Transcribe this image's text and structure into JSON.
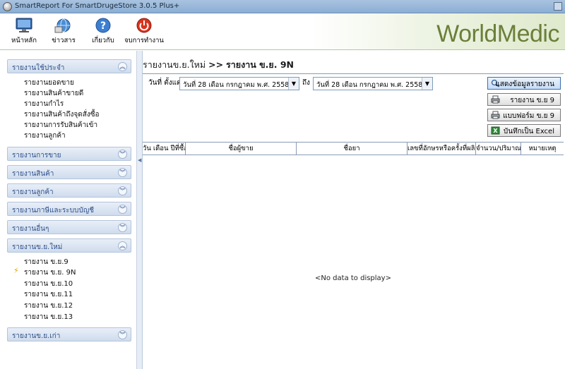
{
  "window": {
    "title": "SmartReport For SmartDrugeStore 3.0.5 Plus+"
  },
  "toolbar": {
    "brand": "WorldMedic",
    "buttons": [
      {
        "label": "หน้าหลัก",
        "icon": "monitor-icon"
      },
      {
        "label": "ข่าวสาร",
        "icon": "globe-icon"
      },
      {
        "label": "เกี่ยวกับ",
        "icon": "help-icon"
      },
      {
        "label": "จบการทำงาน",
        "icon": "power-icon"
      }
    ]
  },
  "sidebar": {
    "groups": [
      {
        "label": "รายงานใช้ประจำ",
        "expanded": true,
        "items": [
          "รายงานยอดขาย",
          "รายงานสินค้าขายดี",
          "รายงานกำไร",
          "รายงานสินค้าถึงจุดสั่งซื้อ",
          "รายงานการรับสินค้าเข้า",
          "รายงานลูกค้า"
        ]
      },
      {
        "label": "รายงานการขาย",
        "expanded": false
      },
      {
        "label": "รายงานสินค้า",
        "expanded": false
      },
      {
        "label": "รายงานลูกค้า",
        "expanded": false
      },
      {
        "label": "รายงานภาษีและระบบบัญชี",
        "expanded": false
      },
      {
        "label": "รายงานอื่นๆ",
        "expanded": false
      },
      {
        "label": "รายงานข.ย.ใหม่",
        "expanded": true,
        "items": [
          "รายงาน ข.ย.9",
          "รายงาน ข.ย. 9N",
          "รายงาน ข.ย.10",
          "รายงาน ข.ย.11",
          "รายงาน ข.ย.12",
          "รายงาน ข.ย.13"
        ],
        "selected": "รายงาน ข.ย. 9N"
      },
      {
        "label": "รายงานข.ย.เก่า",
        "expanded": false
      }
    ]
  },
  "main": {
    "breadcrumb": {
      "parent": "รายงานข.ย.ใหม่",
      "separator": ">>",
      "current": "รายงาน ข.ย. 9N"
    },
    "filter": {
      "from_label": "วันที่ ตั้งแต่",
      "from_value": "วันที่ 28 เดือน กรกฎาคม พ.ศ. 2558",
      "to_label": "ถึง",
      "to_value": "วันที่ 28 เดือน กรกฎาคม พ.ศ. 2558"
    },
    "actions": [
      {
        "label": "แสดงข้อมูลรายงาน",
        "icon": "search-icon"
      },
      {
        "label": "รายงาน ข.ย 9",
        "icon": "printer-icon"
      },
      {
        "label": "แบบฟอร์ม ข.ย 9",
        "icon": "printer-icon"
      },
      {
        "label": "บันทึกเป็น Excel",
        "icon": "excel-icon"
      }
    ],
    "table": {
      "columns": [
        "วัน เดือน ปีที่ซื้อ",
        "ชื่อผู้ขาย",
        "ชื่อยา",
        "เลขที่อักษรหรือครั้งที่ผลิต",
        "จำนวน/ปริมาณ",
        "หมายเหตุ"
      ],
      "empty_text": "<No data to display>"
    }
  },
  "colors": {
    "brand": "#6b7f3a",
    "sidebar_header": "#2f4f8a",
    "titlebar": "#a9c3e0"
  }
}
